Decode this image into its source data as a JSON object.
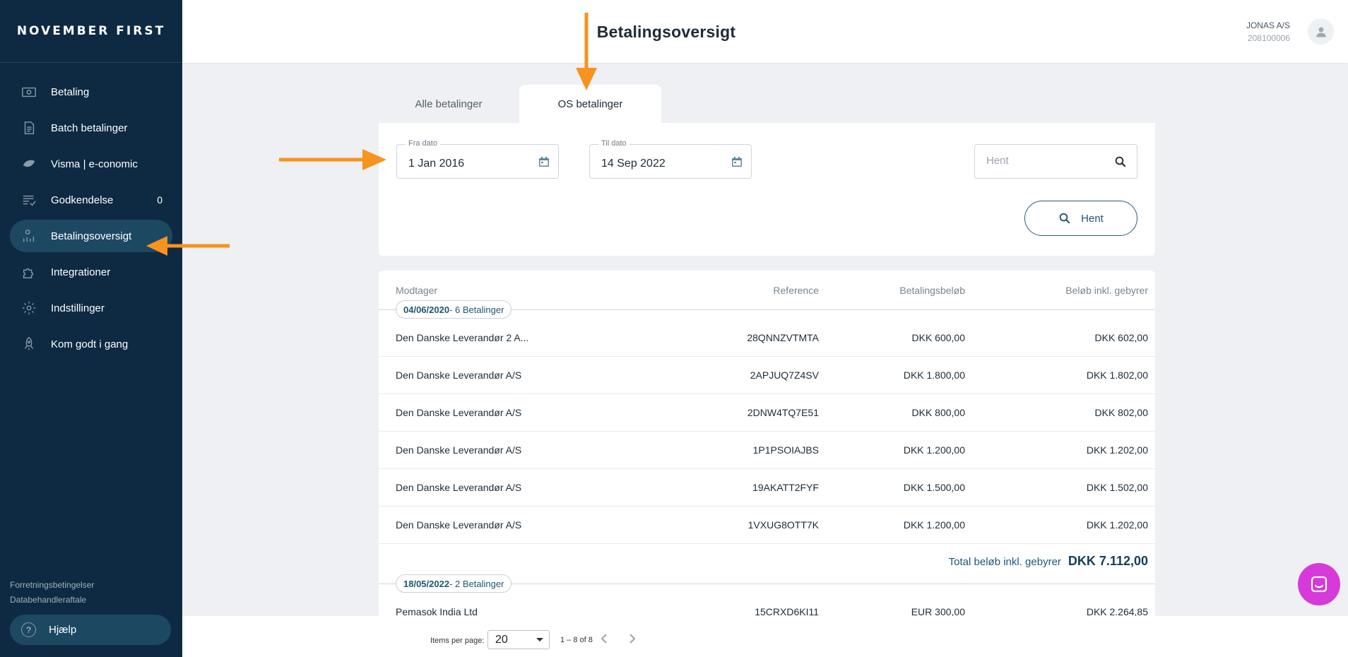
{
  "brand": "NOVEMBER FIRST",
  "sidebar": {
    "items": [
      {
        "label": "Betaling",
        "icon": "banknote-icon"
      },
      {
        "label": "Batch betalinger",
        "icon": "document-icon"
      },
      {
        "label": "Visma | e-conomic",
        "icon": "leaf-icon"
      },
      {
        "label": "Godkendelse",
        "icon": "checklist-icon",
        "count": "0"
      },
      {
        "label": "Betalingsoversigt",
        "icon": "chart-user-icon",
        "active": true
      },
      {
        "label": "Integrationer",
        "icon": "puzzle-icon"
      },
      {
        "label": "Indstillinger",
        "icon": "gear-icon"
      },
      {
        "label": "Kom godt i gang",
        "icon": "rocket-icon"
      }
    ],
    "footer_links": [
      "Forretningsbetingelser",
      "Databehandleraftale"
    ],
    "help_label": "Hjælp"
  },
  "header": {
    "title": "Betalingsoversigt",
    "user_name": "JONAS A/S",
    "user_number": "208100006"
  },
  "tabs": [
    "Alle betalinger",
    "OS betalinger"
  ],
  "filters": {
    "from_label": "Fra dato",
    "from_value": "1 Jan 2016",
    "to_label": "Til dato",
    "to_value": "14 Sep 2022",
    "search_placeholder": "Hent",
    "fetch_button": "Hent"
  },
  "table": {
    "columns": [
      "Modtager",
      "Reference",
      "Betalingsbeløb",
      "Beløb inkl. gebyrer"
    ],
    "groups": [
      {
        "date": "04/06/2020",
        "count_label": "- 6 Betalinger",
        "rows": [
          [
            "Den Danske Leverandør 2 A...",
            "28QNNZVTMTA",
            "DKK 600,00",
            "DKK 602,00"
          ],
          [
            "Den Danske Leverandør A/S",
            "2APJUQ7Z4SV",
            "DKK 1.800,00",
            "DKK 1.802,00"
          ],
          [
            "Den Danske Leverandør A/S",
            "2DNW4TQ7E51",
            "DKK 800,00",
            "DKK 802,00"
          ],
          [
            "Den Danske Leverandør A/S",
            "1P1PSOIAJBS",
            "DKK 1.200,00",
            "DKK 1.202,00"
          ],
          [
            "Den Danske Leverandør A/S",
            "19AKATT2FYF",
            "DKK 1.500,00",
            "DKK 1.502,00"
          ],
          [
            "Den Danske Leverandør A/S",
            "1VXUG8OTT7K",
            "DKK 1.200,00",
            "DKK 1.202,00"
          ]
        ],
        "total_label": "Total beløb inkl. gebyrer",
        "total_value": "DKK 7.112,00"
      },
      {
        "date": "18/05/2022",
        "count_label": "- 2 Betalinger",
        "rows": [
          [
            "Pemasok India Ltd",
            "15CRXD6KI11",
            "EUR 300,00",
            "DKK 2.264,85"
          ]
        ]
      }
    ]
  },
  "paginator": {
    "label": "Items per page:",
    "page_size": "20",
    "range": "1 – 8 of 8"
  },
  "colors": {
    "sidebar": "#0e2a42",
    "accent": "#1f5673",
    "annotation_arrow": "#f7931e",
    "chat": "#d63ad8"
  }
}
